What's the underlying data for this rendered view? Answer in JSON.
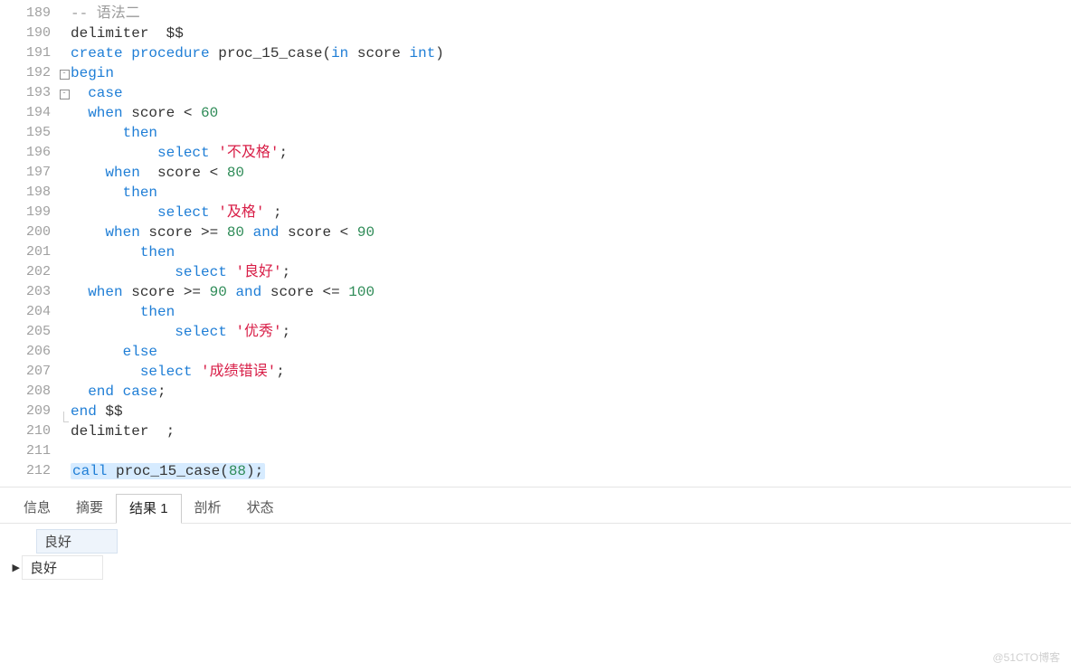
{
  "lines": [
    {
      "n": 189,
      "fold": "",
      "segs": [
        {
          "t": "-- 语法二",
          "c": "c-comment"
        }
      ]
    },
    {
      "n": 190,
      "fold": "",
      "segs": [
        {
          "t": "delimiter  $$",
          "c": "c-ident"
        }
      ]
    },
    {
      "n": 191,
      "fold": "",
      "segs": [
        {
          "t": "create",
          "c": "c-kw"
        },
        {
          "t": " ",
          "c": ""
        },
        {
          "t": "procedure",
          "c": "c-kw"
        },
        {
          "t": " proc_15_case(",
          "c": "c-ident"
        },
        {
          "t": "in",
          "c": "c-kw"
        },
        {
          "t": " score ",
          "c": "c-ident"
        },
        {
          "t": "int",
          "c": "c-kw"
        },
        {
          "t": ")",
          "c": "c-ident"
        }
      ]
    },
    {
      "n": 192,
      "fold": "boxminus",
      "segs": [
        {
          "t": "begin",
          "c": "c-kw"
        }
      ]
    },
    {
      "n": 193,
      "fold": "boxminus",
      "segs": [
        {
          "t": "  ",
          "c": ""
        },
        {
          "t": "case",
          "c": "c-kw"
        }
      ]
    },
    {
      "n": 194,
      "fold": "vline",
      "segs": [
        {
          "t": "  ",
          "c": ""
        },
        {
          "t": "when",
          "c": "c-kw"
        },
        {
          "t": " score < ",
          "c": "c-ident"
        },
        {
          "t": "60",
          "c": "c-num"
        }
      ]
    },
    {
      "n": 195,
      "fold": "vline",
      "segs": [
        {
          "t": "      ",
          "c": ""
        },
        {
          "t": "then",
          "c": "c-kw"
        }
      ]
    },
    {
      "n": 196,
      "fold": "vline",
      "segs": [
        {
          "t": "          ",
          "c": ""
        },
        {
          "t": "select",
          "c": "c-kw"
        },
        {
          "t": " ",
          "c": ""
        },
        {
          "t": "'不及格'",
          "c": "c-str"
        },
        {
          "t": ";",
          "c": "c-ident"
        }
      ]
    },
    {
      "n": 197,
      "fold": "vline",
      "segs": [
        {
          "t": "    ",
          "c": ""
        },
        {
          "t": "when",
          "c": "c-kw"
        },
        {
          "t": "  score < ",
          "c": "c-ident"
        },
        {
          "t": "80",
          "c": "c-num"
        }
      ]
    },
    {
      "n": 198,
      "fold": "vline",
      "segs": [
        {
          "t": "      ",
          "c": ""
        },
        {
          "t": "then",
          "c": "c-kw"
        }
      ]
    },
    {
      "n": 199,
      "fold": "vline",
      "segs": [
        {
          "t": "          ",
          "c": ""
        },
        {
          "t": "select",
          "c": "c-kw"
        },
        {
          "t": " ",
          "c": ""
        },
        {
          "t": "'及格'",
          "c": "c-str"
        },
        {
          "t": " ;",
          "c": "c-ident"
        }
      ]
    },
    {
      "n": 200,
      "fold": "vline",
      "segs": [
        {
          "t": "    ",
          "c": ""
        },
        {
          "t": "when",
          "c": "c-kw"
        },
        {
          "t": " score >= ",
          "c": "c-ident"
        },
        {
          "t": "80",
          "c": "c-num"
        },
        {
          "t": " ",
          "c": ""
        },
        {
          "t": "and",
          "c": "c-kw"
        },
        {
          "t": " score < ",
          "c": "c-ident"
        },
        {
          "t": "90",
          "c": "c-num"
        }
      ]
    },
    {
      "n": 201,
      "fold": "vline",
      "segs": [
        {
          "t": "        ",
          "c": ""
        },
        {
          "t": "then",
          "c": "c-kw"
        }
      ]
    },
    {
      "n": 202,
      "fold": "vline",
      "segs": [
        {
          "t": "            ",
          "c": ""
        },
        {
          "t": "select",
          "c": "c-kw"
        },
        {
          "t": " ",
          "c": ""
        },
        {
          "t": "'良好'",
          "c": "c-str"
        },
        {
          "t": ";",
          "c": "c-ident"
        }
      ]
    },
    {
      "n": 203,
      "fold": "vline",
      "segs": [
        {
          "t": "  ",
          "c": ""
        },
        {
          "t": "when",
          "c": "c-kw"
        },
        {
          "t": " score >= ",
          "c": "c-ident"
        },
        {
          "t": "90",
          "c": "c-num"
        },
        {
          "t": " ",
          "c": ""
        },
        {
          "t": "and",
          "c": "c-kw"
        },
        {
          "t": " score <= ",
          "c": "c-ident"
        },
        {
          "t": "100",
          "c": "c-num"
        }
      ]
    },
    {
      "n": 204,
      "fold": "vline",
      "segs": [
        {
          "t": "        ",
          "c": ""
        },
        {
          "t": "then",
          "c": "c-kw"
        }
      ]
    },
    {
      "n": 205,
      "fold": "vline",
      "segs": [
        {
          "t": "            ",
          "c": ""
        },
        {
          "t": "select",
          "c": "c-kw"
        },
        {
          "t": " ",
          "c": ""
        },
        {
          "t": "'优秀'",
          "c": "c-str"
        },
        {
          "t": ";",
          "c": "c-ident"
        }
      ]
    },
    {
      "n": 206,
      "fold": "vline",
      "segs": [
        {
          "t": "      ",
          "c": ""
        },
        {
          "t": "else",
          "c": "c-kw"
        }
      ]
    },
    {
      "n": 207,
      "fold": "vline",
      "segs": [
        {
          "t": "        ",
          "c": ""
        },
        {
          "t": "select",
          "c": "c-kw"
        },
        {
          "t": " ",
          "c": ""
        },
        {
          "t": "'成绩错误'",
          "c": "c-str"
        },
        {
          "t": ";",
          "c": "c-ident"
        }
      ]
    },
    {
      "n": 208,
      "fold": "vline",
      "segs": [
        {
          "t": "  ",
          "c": ""
        },
        {
          "t": "end",
          "c": "c-kw"
        },
        {
          "t": " ",
          "c": ""
        },
        {
          "t": "case",
          "c": "c-kw"
        },
        {
          "t": ";",
          "c": "c-ident"
        }
      ]
    },
    {
      "n": 209,
      "fold": "endline",
      "segs": [
        {
          "t": "end",
          "c": "c-kw"
        },
        {
          "t": " $$",
          "c": "c-ident"
        }
      ]
    },
    {
      "n": 210,
      "fold": "",
      "segs": [
        {
          "t": "delimiter  ;",
          "c": "c-ident"
        }
      ]
    },
    {
      "n": 211,
      "fold": "",
      "segs": [
        {
          "t": "",
          "c": ""
        }
      ]
    },
    {
      "n": 212,
      "fold": "",
      "hl": true,
      "segs": [
        {
          "t": "call",
          "c": "c-kw"
        },
        {
          "t": " proc_15_case(",
          "c": "c-ident"
        },
        {
          "t": "88",
          "c": "c-num"
        },
        {
          "t": ");",
          "c": "c-ident"
        }
      ]
    }
  ],
  "tabs": {
    "info": "信息",
    "summary": "摘要",
    "result1": "结果 1",
    "profile": "剖析",
    "status": "状态",
    "active": "result1"
  },
  "result": {
    "header": "良好",
    "row_marker": "▶",
    "rows": [
      "良好"
    ]
  },
  "watermark": "@51CTO博客"
}
